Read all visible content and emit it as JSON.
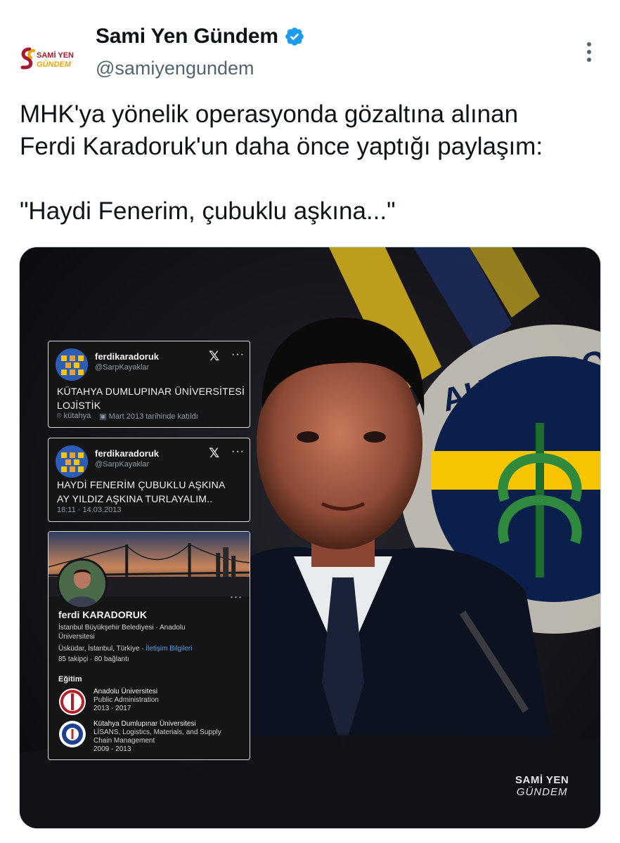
{
  "tweet": {
    "author_name": "Sami Yen Gündem",
    "handle": "@samiyengundem",
    "verified_icon": "verified-badge-icon",
    "avatar_logo_line1": "SAMİ YEN",
    "avatar_logo_line2": "GÜNDEM",
    "more_icon": "more-vertical-icon",
    "text_lines": [
      "MHK'ya yönelik operasyonda gözaltına alınan",
      "Ferdi Karadoruk'un daha önce yaptığı paylaşım:",
      "\"Haydi Fenerim, çubuklu aşkına...\""
    ]
  },
  "media": {
    "background_emblem_text": "AHÇE SPOR",
    "watermark_line1": "SAMİ YEN",
    "watermark_line2": "GÜNDEM",
    "card1": {
      "username": "ferdikaradoruk",
      "handle": "@SarpKayaklar",
      "bio_line1": "KÜTAHYA DUMLUPINAR ÜNİVERSİTESİ",
      "bio_line2": "LOJİSTİK",
      "location": "kütahya",
      "joined": "Mart 2013 tarihinde katıldı"
    },
    "card2": {
      "username": "ferdikaradoruk",
      "handle": "@SarpKayaklar",
      "text_line1": "HAYDİ FENERİM ÇUBUKLU AŞKINA",
      "text_line2": "AY YILDIZ AŞKINA TURLAYALIM..",
      "timestamp": "18:11 · 14.03.2013"
    },
    "card3": {
      "name": "ferdi KARADORUK",
      "headline_line1": "İstanbul Büyükşehir Belediyesi · Anadolu",
      "headline_line2": "Üniversitesi",
      "location": "Üsküdar, İstanbul, Türkiye ·",
      "contact_link": "İletişim Bilgileri",
      "followers": "85 takipçi",
      "connections": "80 bağlantı",
      "education_heading": "Eğitim",
      "education": [
        {
          "school": "Anadolu Üniversitesi",
          "lines": [
            "Public Administration",
            "2013 - 2017"
          ]
        },
        {
          "school": "Kütahya Dumlupınar Üniversitesi",
          "lines": [
            "LİSANS, Logistics, Materials, and Supply",
            "Chain Management",
            "2009 - 2013"
          ]
        }
      ]
    }
  },
  "colors": {
    "verified_blue": "#1d9bf0",
    "galatasaray_red": "#a6192e",
    "galatasaray_yellow": "#f0a500",
    "fb_navy": "#0b1f4b",
    "fb_yellow": "#f6c400"
  }
}
